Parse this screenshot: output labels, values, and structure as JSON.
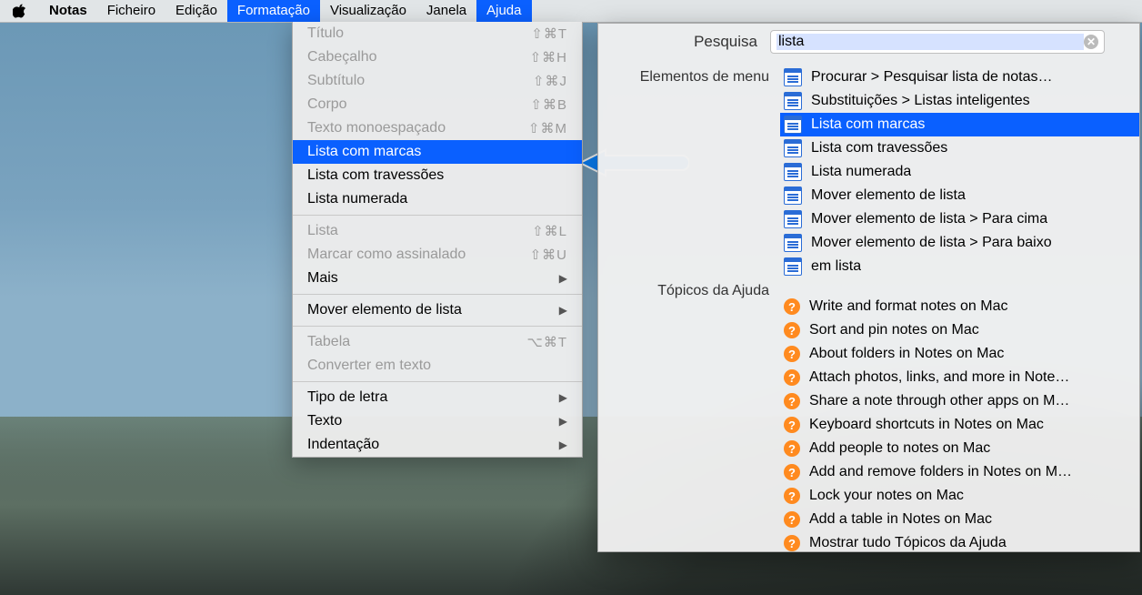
{
  "menubar": {
    "apple": "",
    "app": "Notas",
    "items": [
      "Ficheiro",
      "Edição",
      "Formatação",
      "Visualização",
      "Janela",
      "Ajuda"
    ]
  },
  "format_menu": {
    "groups": [
      [
        {
          "label": "Título",
          "shortcut": "⇧⌘T",
          "disabled": true
        },
        {
          "label": "Cabeçalho",
          "shortcut": "⇧⌘H",
          "disabled": true
        },
        {
          "label": "Subtítulo",
          "shortcut": "⇧⌘J",
          "disabled": true
        },
        {
          "label": "Corpo",
          "shortcut": "⇧⌘B",
          "disabled": true
        },
        {
          "label": "Texto monoespaçado",
          "shortcut": "⇧⌘M",
          "disabled": true
        },
        {
          "label": "Lista com marcas",
          "shortcut": "",
          "selected": true
        },
        {
          "label": "Lista com travessões",
          "shortcut": ""
        },
        {
          "label": "Lista numerada",
          "shortcut": ""
        }
      ],
      [
        {
          "label": "Lista",
          "shortcut": "⇧⌘L",
          "disabled": true
        },
        {
          "label": "Marcar como assinalado",
          "shortcut": "⇧⌘U",
          "disabled": true
        },
        {
          "label": "Mais",
          "submenu": true
        }
      ],
      [
        {
          "label": "Mover elemento de lista",
          "submenu": true
        }
      ],
      [
        {
          "label": "Tabela",
          "shortcut": "⌥⌘T",
          "disabled": true
        },
        {
          "label": "Converter em texto",
          "disabled": true
        }
      ],
      [
        {
          "label": "Tipo de letra",
          "submenu": true
        },
        {
          "label": "Texto",
          "submenu": true
        },
        {
          "label": "Indentação",
          "submenu": true
        }
      ]
    ]
  },
  "help": {
    "search_label": "Pesquisa",
    "search_value": "lista",
    "section_menu": "Elementos de menu",
    "section_topics": "Tópicos da Ajuda",
    "menu_results": [
      {
        "label": "Procurar > Pesquisar lista de notas…"
      },
      {
        "label": "Substituições > Listas inteligentes"
      },
      {
        "label": "Lista com marcas",
        "selected": true
      },
      {
        "label": "Lista com travessões"
      },
      {
        "label": "Lista numerada"
      },
      {
        "label": "Mover elemento de lista"
      },
      {
        "label": "Mover elemento de lista > Para cima"
      },
      {
        "label": "Mover elemento de lista > Para baixo"
      },
      {
        "label": "em lista"
      }
    ],
    "topic_results": [
      {
        "label": "Write and format notes on Mac"
      },
      {
        "label": "Sort and pin notes on Mac"
      },
      {
        "label": "About folders in Notes on Mac"
      },
      {
        "label": "Attach photos, links, and more in Note…"
      },
      {
        "label": "Share a note through other apps on M…"
      },
      {
        "label": "Keyboard shortcuts in Notes on Mac"
      },
      {
        "label": "Add people to notes on Mac"
      },
      {
        "label": "Add and remove folders in Notes on M…"
      },
      {
        "label": "Lock your notes on Mac"
      },
      {
        "label": "Add a table in Notes on Mac"
      },
      {
        "label": "Mostrar tudo Tópicos da Ajuda"
      }
    ]
  }
}
